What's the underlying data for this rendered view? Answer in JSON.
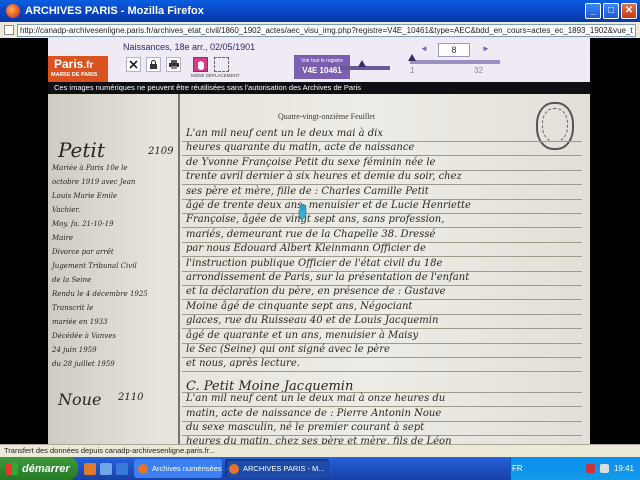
{
  "window": {
    "title": "ARCHIVES PARIS - Mozilla Firefox",
    "minimize": "_",
    "maximize": "□",
    "close": "✕"
  },
  "addressbar": {
    "url": "http://canadp-archivesenligne.paris.fr/archives_etat_civil/1860_1902_actes/aec_visu_img.php?registre=V4E_10461&type=AEC&bdd_en_cours=actes_ec_1893_1902&vue_tranche_debut=AD07..."
  },
  "viewer": {
    "record_title": "Naissances, 18e arr., 02/05/1901",
    "logo_main": "Paris",
    "logo_suffix": ".fr",
    "logo_sub": "MAIRIE DE PARIS",
    "mode_label": "MODE DÉPLACEMENT",
    "registre_line1": "Voir tout le registre",
    "registre_line2": "V4E 10461",
    "page_current": "8",
    "page_first": "1",
    "page_last": "32",
    "nav_prev": "◄",
    "nav_next": "►",
    "notice": "Ces images numériques ne peuvent être réutilisées sans l'autorisation des Archives de Paris",
    "icons": [
      "close-icon",
      "lock-icon",
      "print-icon",
      "hand-icon",
      "select-icon",
      "brightness-icon"
    ]
  },
  "document": {
    "header_print": "Quatre-vingt-onzième Feuillet",
    "margin_name_1": "Petit",
    "margin_num_1": "2109",
    "margin_name_2": "Noue",
    "margin_num_2": "2110",
    "margin_lines": [
      "Mariée à Paris 10e le",
      "octobre 1919 avec Jean",
      "Louis Marie Emile",
      "Vachier.",
      "Moy. fa. 21-10-19",
      "Maire",
      "Divorce par arrêt",
      "Jugement Tribunal Civil",
      "de la Seine",
      "Rendu le 4 décembre 1925",
      "Transcrit le",
      "mariée en 1933",
      "Décédée à Vanves",
      "24 juin 1959",
      "du 28 juillet 1959"
    ],
    "body_lines": [
      "L'an mil neuf cent un le deux mai à dix",
      "heures quarante du matin, acte de naissance",
      "de Yvonne Françoise Petit du sexe féminin née le",
      "trente avril dernier à six heures et demie du soir, chez",
      "ses père et mère, fille de : Charles Camille Petit",
      "âgé de trente deux ans, menuisier et de Lucie Henriette",
      "Françoise, âgée de vingt sept ans, sans profession,",
      "mariés, demeurant rue de la Chapelle 38. Dressé",
      "par nous Edouard Albert Kleinmann Officier de",
      "l'instruction publique Officier de l'état civil du 18e",
      "arrondissement de Paris, sur la présentation de l'enfant",
      "et la déclaration du père, en présence de : Gustave",
      "Moine âgé de cinquante sept ans, Négociant",
      "glaces, rue du Ruisseau 40 et de Louis Jacquemin",
      "âgé de quarante et un ans, menuisier à Maisy",
      "le Sec (Seine) qui ont signé avec le père",
      "et nous, après lecture.",
      "C. Petit   Moine   Jacquemin",
      "L'an mil neuf cent un le deux mai à onze heures du",
      "matin, acte de naissance de : Pierre Antonin Noue",
      "du sexe masculin, né le premier courant à sept",
      "heures du matin, chez ses père et mère, fils de Léon"
    ]
  },
  "statusbar": {
    "text": "Transfert des données depuis canadp-archivesenligne.paris.fr..."
  },
  "taskbar": {
    "start_label": "démarrer",
    "tasks": [
      {
        "label": "Archives numérisées -",
        "active": false
      },
      {
        "label": "ARCHIVES PARIS - M...",
        "active": true
      }
    ],
    "lang": "FR",
    "time": "19:41"
  }
}
